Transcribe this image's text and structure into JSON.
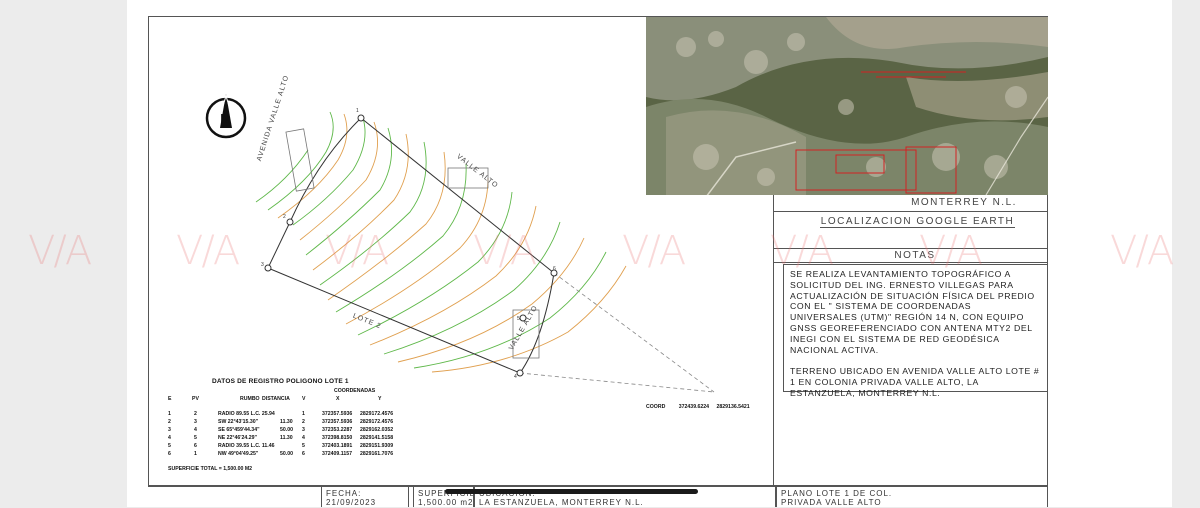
{
  "location": {
    "city": "MONTERREY N.L.",
    "caption": "LOCALIZACION GOOGLE EARTH"
  },
  "notes": {
    "title": "NOTAS",
    "text": "SE REALIZA LEVANTAMIENTO TOPOGRÁFICO A SOLICITUD DEL ING. ERNESTO VILLEGAS PARA ACTUALIZACIÓN DE SITUACIÓN FÍSICA DEL PREDIO CON EL \" SISTEMA DE COORDENADAS UNIVERSALES (UTM)\" REGIÓN 14 N, CON EQUIPO GNSS GEOREFERENCIADO CON ANTENA MTY2 DEL INEGI CON EL SISTEMA DE RED GEODÉSICA NACIONAL ACTIVA.\n\nTERRENO UBICADO EN AVENIDA VALLE ALTO LOTE # 1 EN COLONIA PRIVADA VALLE ALTO, LA ESTANZUELA, MONTERREY N.L."
  },
  "plan": {
    "north": "N",
    "street_labels": [
      "AVENIDA VALLE ALTO",
      "VALLE ALTO",
      "LOTE 2",
      "VALLE ALTO"
    ],
    "vertex_labels": [
      "1",
      "2",
      "3",
      "4",
      "5",
      "6"
    ]
  },
  "table": {
    "title": "DATOS DE REGISTRO POLIGONO LOTE 1",
    "coords_header": "COORDENADAS",
    "headers": [
      "E",
      "PV",
      "RUMBO",
      "DISTANCIA",
      "V",
      "X",
      "Y"
    ],
    "rows": [
      [
        "1",
        "2",
        "RADIO 89.55  L.C. 25.94",
        "",
        "1",
        "372357.5936",
        "2829172.4576"
      ],
      [
        "2",
        "3",
        "SW 22°43'15.30\"",
        "11.30",
        "2",
        "372357.5936",
        "2829172.4576"
      ],
      [
        "3",
        "4",
        "SE 65°459'44.34\"",
        "50.00",
        "3",
        "372353.2287",
        "2829162.0352"
      ],
      [
        "4",
        "5",
        "NE 22°46'24.29\"",
        "11.30",
        "4",
        "372398.8150",
        "2829141.5158"
      ],
      [
        "5",
        "6",
        "RADIO 39.55  L.C. 11.46",
        "",
        "5",
        "372403.1891",
        "2829151.9309"
      ],
      [
        "6",
        "1",
        "NW 49°04'49.25\"",
        "50.00",
        "6",
        "372409.1157",
        "2829161.7076"
      ]
    ],
    "total": "SUPERFICIE TOTAL = 1,500.00 M2"
  },
  "coord_point": {
    "label": "COORD",
    "x": "372439.6224",
    "y": "2829136.5421"
  },
  "titleblock": {
    "fecha_label": "FECHA:",
    "fecha_value": "21/09/2023",
    "superficie_label": "SUPERFICIE:",
    "superficie_value": "1,500.00 m2",
    "ubicacion_label": "UBICACION:",
    "ubicacion_value": "LA ESTANZUELA, MONTERREY N.L.",
    "plano_label": "PLANO LOTE 1   DE COL.",
    "plano_value": "PRIVADA VALLE ALTO"
  },
  "watermark": "V/A",
  "colors": {
    "contour_green": "#5fb84a",
    "contour_orange": "#e0a050",
    "boundary": "#333333",
    "red_marker": "#d22222"
  }
}
